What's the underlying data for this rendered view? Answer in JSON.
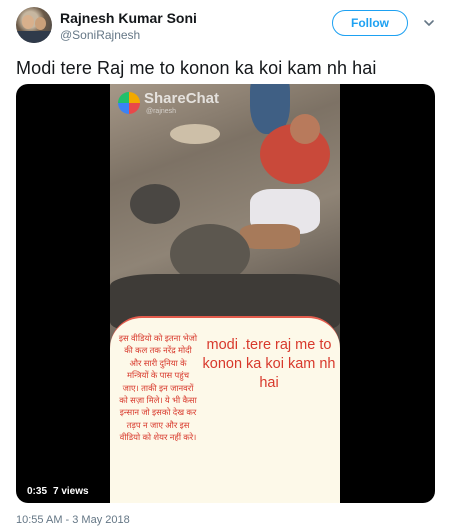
{
  "author": {
    "name": "Rajnesh Kumar Soni",
    "handle": "@SoniRajnesh"
  },
  "follow_label": "Follow",
  "tweet_text": "Modi tere Raj me to konon ka koi kam nh hai",
  "media": {
    "watermark": "ShareChat",
    "watermark_sub": "@rajnesh",
    "hindi_text": "इस वीडियो को इतना भेजो की कल तक नरेंद्र मोदी और सारी दुनिया के मन्त्रियों के पास पहुंच जाए। ताकी इन जानवरों को सज़ा मिले। ये भी कैसा इन्सान जो इसको देख कर तड़प न जाए और इस वीडियो को शेयर नहीं करे।",
    "caption": "modi .tere raj me to konon ka koi kam nh hai",
    "duration": "0:35",
    "views": "7 views"
  },
  "timestamp": "10:55 AM - 3 May 2018",
  "colors": {
    "accent": "#1da1f2",
    "caption": "#d8392c",
    "secondary_text": "#657786"
  },
  "icons": {
    "caret": "chevron-down-icon",
    "avatar": "avatar"
  }
}
